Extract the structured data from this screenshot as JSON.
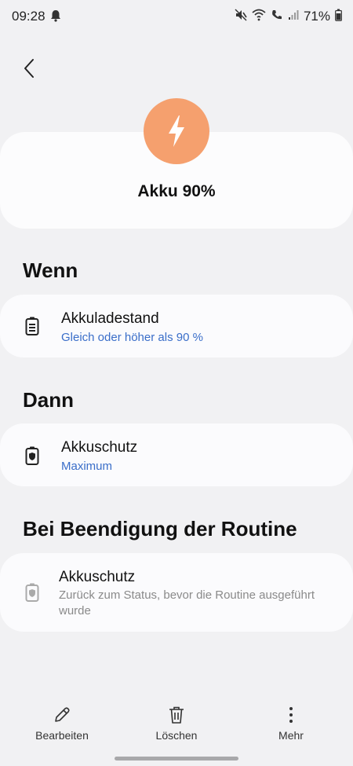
{
  "status_bar": {
    "time": "09:28",
    "battery": "71%"
  },
  "header": {
    "title": "Akku 90%",
    "accent_color": "#f5a06e"
  },
  "sections": {
    "wenn": {
      "heading": "Wenn",
      "item": {
        "title": "Akkuladestand",
        "subtitle": "Gleich oder höher als 90 %",
        "icon": "battery-level-icon"
      }
    },
    "dann": {
      "heading": "Dann",
      "item": {
        "title": "Akkuschutz",
        "subtitle": "Maximum",
        "icon": "battery-protect-icon"
      }
    },
    "ende": {
      "heading": "Bei Beendigung der Routine",
      "item": {
        "title": "Akkuschutz",
        "subtitle": "Zurück zum Status, bevor die Routine ausgeführt wurde",
        "icon": "battery-protect-icon"
      }
    }
  },
  "bottom_bar": {
    "edit_label": "Bearbeiten",
    "delete_label": "Löschen",
    "more_label": "Mehr"
  },
  "colors": {
    "link": "#3a6ec9",
    "background": "#f1f1f3",
    "card": "#fbfbfd"
  }
}
